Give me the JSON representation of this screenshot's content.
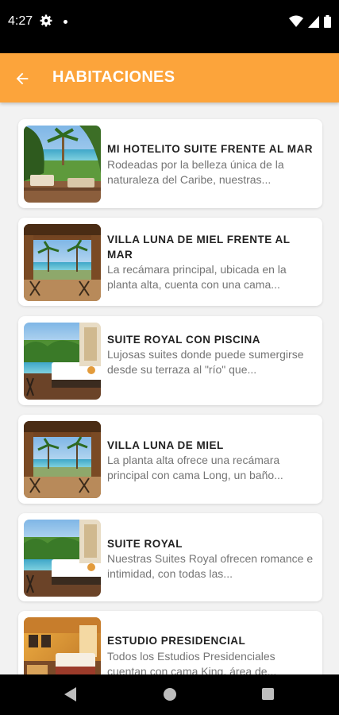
{
  "status_bar": {
    "time": "4:27"
  },
  "header": {
    "title": "HABITACIONES",
    "back_icon": "arrow-back-icon"
  },
  "rooms": [
    {
      "title": "MI HOTELITO SUITE FRENTE AL MAR",
      "description": "Rodeadas por la belleza única de la naturaleza del Caribe, nuestras..."
    },
    {
      "title": "VILLA LUNA DE MIEL FRENTE AL MAR",
      "description": "La recámara principal, ubicada en la planta alta, cuenta con una cama..."
    },
    {
      "title": "SUITE ROYAL CON PISCINA",
      "description": "Lujosas suites donde puede sumergirse desde su terraza al \"río\" que..."
    },
    {
      "title": "VILLA LUNA DE MIEL",
      "description": "La planta alta ofrece una recámara principal con cama Long, un baño..."
    },
    {
      "title": "SUITE ROYAL",
      "description": "Nuestras Suites Royal ofrecen romance e intimidad, con todas las..."
    },
    {
      "title": "ESTUDIO PRESIDENCIAL",
      "description": "Todos los Estudios Presidenciales cuentan con cama King, área de..."
    }
  ],
  "colors": {
    "accent": "#fca43b",
    "background": "#f2f2f2",
    "card": "#ffffff"
  }
}
